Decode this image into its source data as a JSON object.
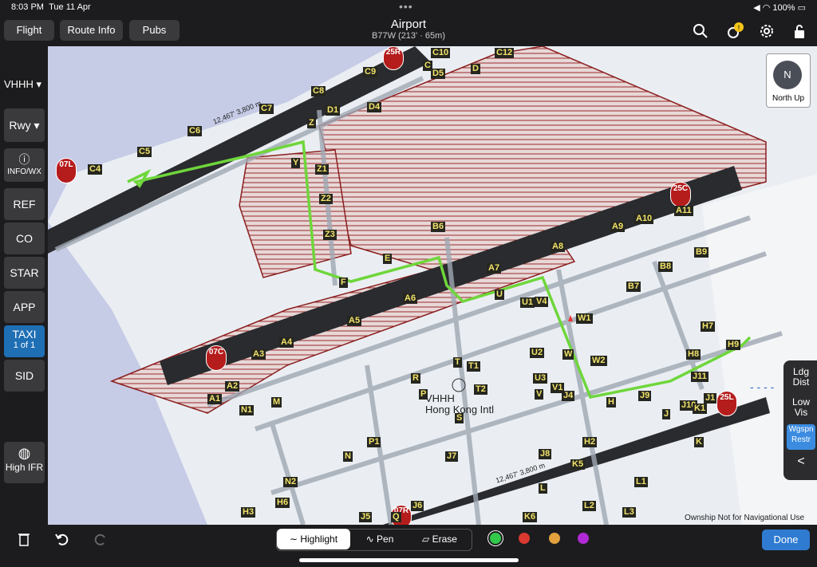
{
  "status": {
    "time": "8:03 PM",
    "date": "Tue 11 Apr",
    "battery": "100%"
  },
  "toolbar": {
    "flight": "Flight",
    "route_info": "Route Info",
    "pubs": "Pubs"
  },
  "header": {
    "title": "Airport",
    "subtitle": "B77W (213' · 65m)"
  },
  "sidebar": {
    "airport": "VHHH",
    "rwy": "Rwy",
    "info": "INFO/WX",
    "items": [
      "REF",
      "CO",
      "STAR",
      "APP",
      "TAXI",
      "SID"
    ],
    "taxi_page": "1 of 1",
    "high_ifr": "High IFR"
  },
  "map": {
    "airport_name": "VHHH",
    "airport_full": "Hong Kong Intl",
    "runway_north_length": "12,467' 3,800 m",
    "runway_south_length": "12,467' 3,800 m",
    "runways": [
      "07L",
      "25R",
      "07C",
      "25C",
      "07R",
      "25L"
    ],
    "disclaimer": "Ownship Not for Navigational Use",
    "north_up": "North Up",
    "north_letter": "N",
    "taxiway_labels": [
      "C10",
      "C12",
      "C",
      "D",
      "C9",
      "D5",
      "C8",
      "C7",
      "D1",
      "D4",
      "C6",
      "C5",
      "C4",
      "A10",
      "A11",
      "A9",
      "A8",
      "A7",
      "A6",
      "A5",
      "A4",
      "A3",
      "A2",
      "A1",
      "B6",
      "B7",
      "B8",
      "B9",
      "E",
      "F",
      "Y",
      "Z",
      "Z1",
      "Z2",
      "Z3",
      "W",
      "W1",
      "W2",
      "H",
      "H7",
      "H8",
      "H9",
      "J",
      "J1",
      "J9",
      "J10",
      "J11",
      "K",
      "K1",
      "K5",
      "K6",
      "L",
      "L1",
      "L2",
      "L3",
      "M",
      "N",
      "N1",
      "N2",
      "P",
      "P1",
      "Q",
      "R",
      "S",
      "T",
      "T1",
      "T2",
      "U",
      "U1",
      "U2",
      "U3",
      "V",
      "V1",
      "V4",
      "J4",
      "J5",
      "J6",
      "J7",
      "J8",
      "H2",
      "H3",
      "H6"
    ]
  },
  "right_panel": {
    "ldg": "Ldg Dist",
    "lowvis": "Low Vis",
    "wgspn": "Wgspn Restr"
  },
  "bottom": {
    "highlight": "Highlight",
    "pen": "Pen",
    "erase": "Erase",
    "done": "Done"
  },
  "colors": {
    "active": "#1f6fb5",
    "route": "#6fd63b",
    "runway_marker": "#b51c1c",
    "taxiway_label_bg": "#25261f",
    "taxiway_label_text": "#f2e36a"
  }
}
